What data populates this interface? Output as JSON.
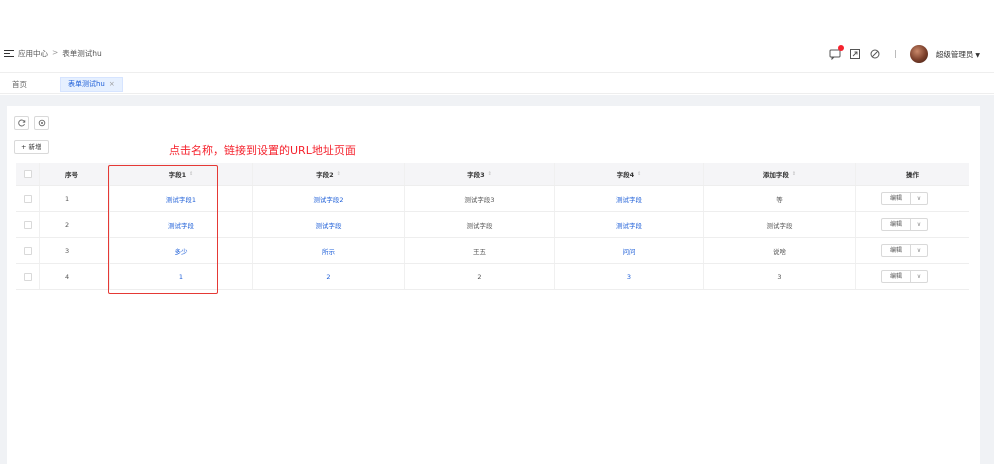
{
  "breadcrumb": {
    "root": "应用中心",
    "separator": ">",
    "current": "表单测试hu"
  },
  "user": {
    "name": "超级管理员"
  },
  "tabs": {
    "home": "首页",
    "active": "表单测试hu",
    "close": "×"
  },
  "toolbar": {
    "add_label": "+ 新增"
  },
  "annotation": {
    "text": "点击名称，链接到设置的URL地址页面"
  },
  "table": {
    "columns": {
      "no": "序号",
      "field1": "字段1",
      "field2": "字段2",
      "field3": "字段3",
      "field4": "字段4",
      "added": "添加字段",
      "op": "操作"
    },
    "rows": [
      {
        "no": "1",
        "field1": "测试字段1",
        "field2": "测试字段2",
        "field3": "测试字段3",
        "field4": "测试字段",
        "added": "等"
      },
      {
        "no": "2",
        "field1": "测试字段",
        "field2": "测试字段",
        "field3": "测试字段",
        "field4": "测试字段",
        "added": "测试字段"
      },
      {
        "no": "3",
        "field1": "多少",
        "field2": "所示",
        "field3": "王五",
        "field4": "问问",
        "added": "说啥"
      },
      {
        "no": "4",
        "field1": "1",
        "field2": "2",
        "field3": "2",
        "field4": "3",
        "added": "3"
      }
    ],
    "row_actions": {
      "edit": "编辑",
      "more": "∨"
    }
  },
  "icons": {
    "menu": "menu-fold-icon",
    "message": "message-icon",
    "fullscreen": "fullscreen-icon",
    "skin": "skin-icon",
    "refresh": "refresh-icon",
    "settings": "settings-icon"
  },
  "colors": {
    "link": "#1e5fd8",
    "annotation": "#f5222d",
    "badge": "#f5222d"
  }
}
